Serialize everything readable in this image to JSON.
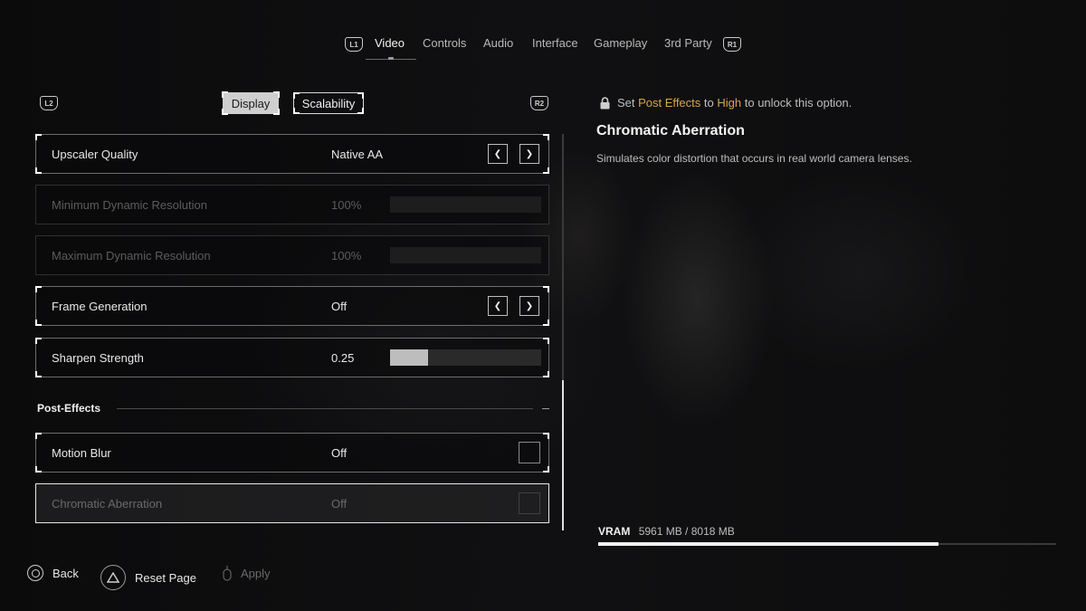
{
  "top_nav": {
    "left_hint": "L1",
    "right_hint": "R1",
    "tabs": [
      {
        "label": "Video",
        "active": true
      },
      {
        "label": "Controls",
        "active": false
      },
      {
        "label": "Audio",
        "active": false
      },
      {
        "label": "Interface",
        "active": false
      },
      {
        "label": "Gameplay",
        "active": false
      },
      {
        "label": "3rd Party",
        "active": false
      }
    ]
  },
  "sub_nav": {
    "left_hint": "L2",
    "right_hint": "R2",
    "tabs": [
      {
        "label": "Display",
        "active": true
      },
      {
        "label": "Scalability",
        "active": false
      }
    ]
  },
  "settings": [
    {
      "label": "Upscaler Quality",
      "value": "Native AA",
      "control": "arrows",
      "state": "enabled"
    },
    {
      "label": "Minimum Dynamic Resolution",
      "value": "100%",
      "control": "slider",
      "state": "disabled",
      "slider_fraction": 0
    },
    {
      "label": "Maximum Dynamic Resolution",
      "value": "100%",
      "control": "slider",
      "state": "disabled",
      "slider_fraction": 0
    },
    {
      "label": "Frame Generation",
      "value": "Off",
      "control": "arrows",
      "state": "enabled"
    },
    {
      "label": "Sharpen Strength",
      "value": "0.25",
      "control": "slider",
      "state": "enabled",
      "slider_fraction": 0.25
    }
  ],
  "section": {
    "title": "Post-Effects"
  },
  "post_effects": [
    {
      "label": "Motion Blur",
      "value": "Off",
      "control": "checkbox",
      "state": "enabled"
    },
    {
      "label": "Chromatic Aberration",
      "value": "Off",
      "control": "checkbox",
      "state": "selected-locked"
    }
  ],
  "info_panel": {
    "lock_prefix": "Set",
    "lock_setting": "Post Effects",
    "lock_middle": "to",
    "lock_level": "High",
    "lock_suffix": "to unlock this option.",
    "title": "Chromatic Aberration",
    "description": "Simulates color distortion that occurs in real world camera lenses.",
    "highlight_color": "#d9a64a"
  },
  "vram": {
    "label": "VRAM",
    "value": "5961 MB / 8018 MB",
    "used_fraction": 0.743
  },
  "bottom_actions": [
    {
      "icon": "circle-button-icon",
      "label": "Back",
      "enabled": true
    },
    {
      "icon": "triangle-button-icon",
      "label": "Reset Page",
      "enabled": true
    },
    {
      "icon": "touchpad-icon",
      "label": "Apply",
      "enabled": false
    }
  ],
  "scroll": {
    "position_fraction": 0.62
  }
}
